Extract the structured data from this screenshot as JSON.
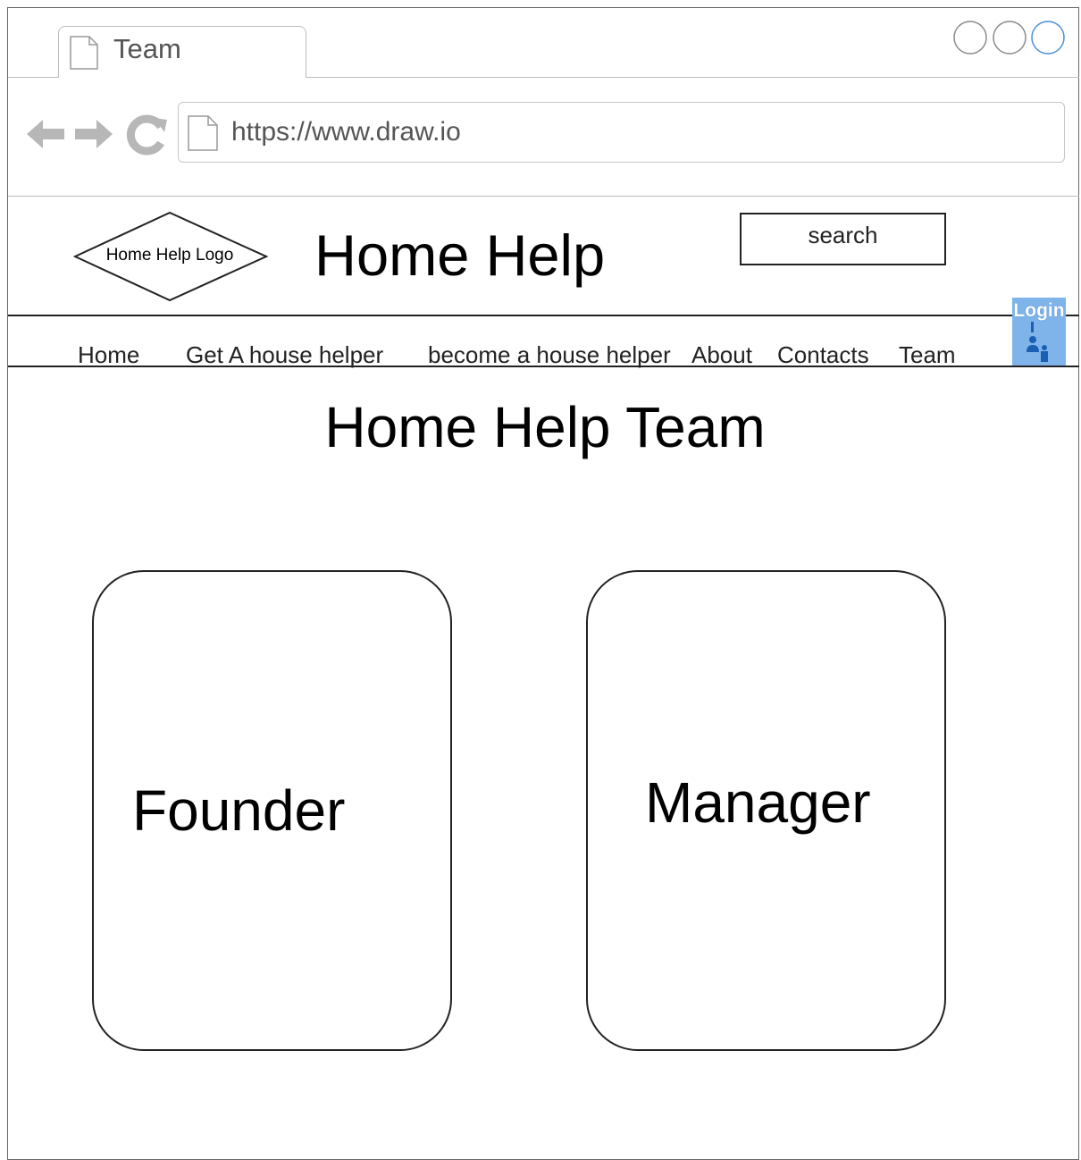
{
  "browser": {
    "tab_title": "Team",
    "url": "https://www.draw.io"
  },
  "header": {
    "logo_text": "Home Help Logo",
    "site_title": "Home Help",
    "search_placeholder": "search",
    "login_label": "Login"
  },
  "nav": {
    "items": [
      {
        "label": "Home"
      },
      {
        "label": "Get A house helper"
      },
      {
        "label": "become a house helper"
      },
      {
        "label": "About"
      },
      {
        "label": "Contacts"
      },
      {
        "label": "Team"
      }
    ]
  },
  "main": {
    "heading": "Home Help Team",
    "cards": [
      {
        "label": "Founder"
      },
      {
        "label": "Manager"
      }
    ]
  },
  "colors": {
    "login_accent": "#7eb4ea",
    "window_button_active": "#4a90d9",
    "chrome_gray": "#bdbdbd"
  }
}
